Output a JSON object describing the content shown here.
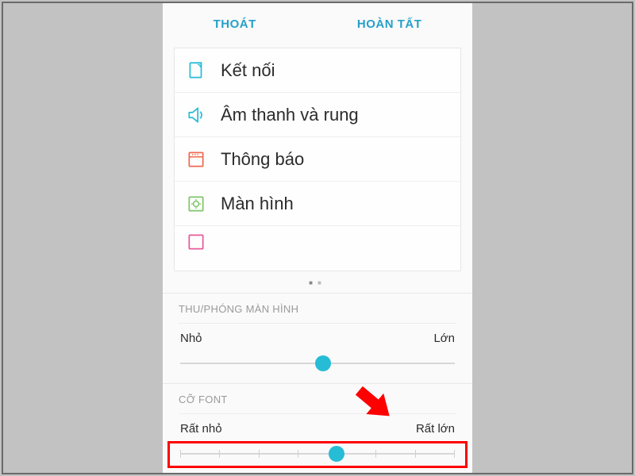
{
  "topbar": {
    "cancel": "THOÁT",
    "done": "HOÀN TẤT"
  },
  "settings_list": [
    {
      "id": "connections",
      "label": "Kết nối",
      "icon": "connections-icon",
      "color": "#27bcd6"
    },
    {
      "id": "sound",
      "label": "Âm thanh và rung",
      "icon": "sound-icon",
      "color": "#27bcd6"
    },
    {
      "id": "notifications",
      "label": "Thông báo",
      "icon": "notifications-icon",
      "color": "#ef6a4f"
    },
    {
      "id": "display",
      "label": "Màn hình",
      "icon": "display-icon",
      "color": "#7fc66b"
    }
  ],
  "zoom": {
    "title": "THU/PHÓNG MÀN HÌNH",
    "min_label": "Nhỏ",
    "max_label": "Lớn",
    "value_pct": 52
  },
  "font": {
    "title": "CỠ FONT",
    "min_label": "Rất nhỏ",
    "max_label": "Rất lớn",
    "value_pct": 57,
    "ticks": 8
  }
}
